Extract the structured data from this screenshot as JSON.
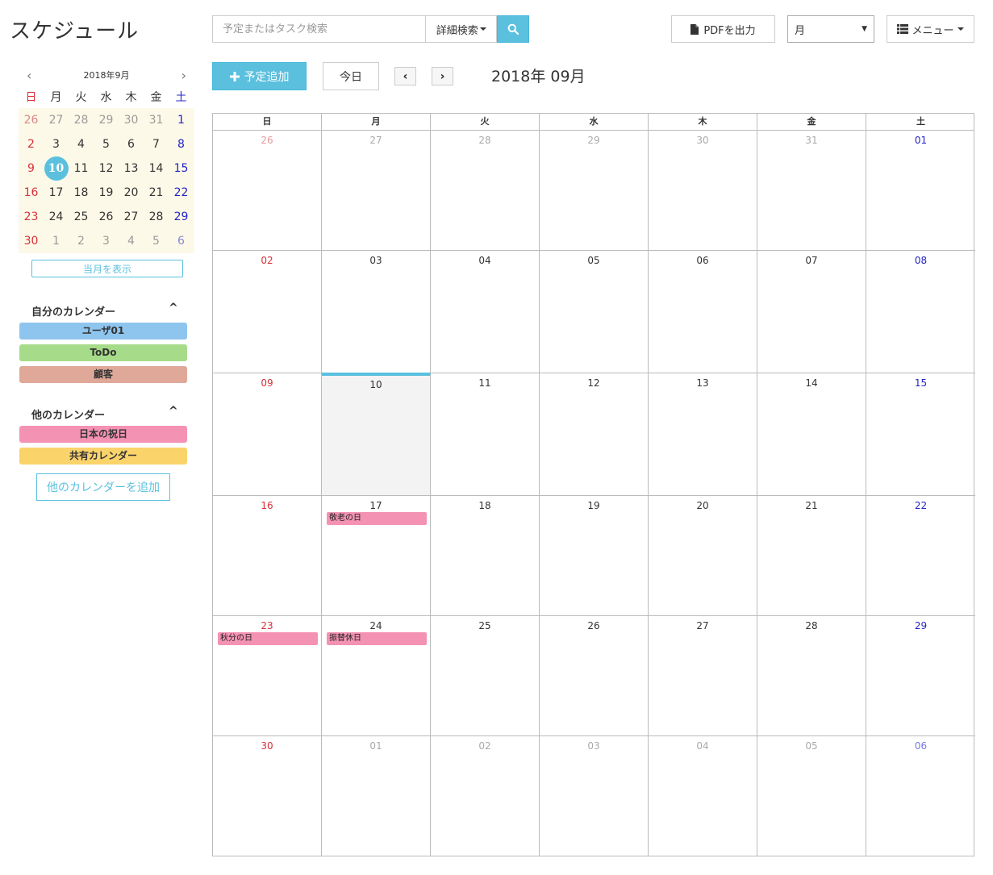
{
  "app_title": "スケジュール",
  "search": {
    "placeholder": "予定またはタスク検索",
    "advanced_label": "詳細検索"
  },
  "toolbar": {
    "pdf_label": "PDFを出力",
    "view_value": "月",
    "menu_label": "メニュー"
  },
  "nav": {
    "add_label": "予定追加",
    "today_label": "今日",
    "prev": "‹",
    "next": "›",
    "month_title": "2018年 09月"
  },
  "weekdays": [
    "日",
    "月",
    "火",
    "水",
    "木",
    "金",
    "土"
  ],
  "calendar": {
    "weeks": [
      [
        "26",
        "27",
        "28",
        "29",
        "30",
        "31",
        "01"
      ],
      [
        "02",
        "03",
        "04",
        "05",
        "06",
        "07",
        "08"
      ],
      [
        "09",
        "10",
        "11",
        "12",
        "13",
        "14",
        "15"
      ],
      [
        "16",
        "17",
        "18",
        "19",
        "20",
        "21",
        "22"
      ],
      [
        "23",
        "24",
        "25",
        "26",
        "27",
        "28",
        "29"
      ],
      [
        "30",
        "01",
        "02",
        "03",
        "04",
        "05",
        "06"
      ]
    ],
    "events": [
      {
        "week": 3,
        "day": 1,
        "label": "敬老の日"
      },
      {
        "week": 4,
        "day": 0,
        "label": "秋分の日"
      },
      {
        "week": 4,
        "day": 1,
        "label": "振替休日"
      }
    ]
  },
  "mini_calendar": {
    "title": "2018年9月",
    "prev": "‹",
    "next": "›",
    "weeks": [
      [
        "26",
        "27",
        "28",
        "29",
        "30",
        "31",
        "1"
      ],
      [
        "2",
        "3",
        "4",
        "5",
        "6",
        "7",
        "8"
      ],
      [
        "9",
        "10",
        "11",
        "12",
        "13",
        "14",
        "15"
      ],
      [
        "16",
        "17",
        "18",
        "19",
        "20",
        "21",
        "22"
      ],
      [
        "23",
        "24",
        "25",
        "26",
        "27",
        "28",
        "29"
      ],
      [
        "30",
        "1",
        "2",
        "3",
        "4",
        "5",
        "6"
      ]
    ],
    "show_month_label": "当月を表示"
  },
  "my_calendars": {
    "title": "自分のカレンダー",
    "toggle": "^",
    "items": [
      {
        "label": "ユーザ01",
        "color": "#8ec5ef"
      },
      {
        "label": "ToDo",
        "color": "#a6db8a"
      },
      {
        "label": "顧客",
        "color": "#e0a898"
      }
    ]
  },
  "other_calendars": {
    "title": "他のカレンダー",
    "toggle": "^",
    "items": [
      {
        "label": "日本の祝日",
        "color": "#f492b4"
      },
      {
        "label": "共有カレンダー",
        "color": "#fbd36b"
      }
    ],
    "add_label": "他のカレンダーを追加"
  },
  "colors": {
    "accent": "#5bc0de",
    "sunday": "#d9303a",
    "saturday": "#2424c9",
    "holiday_event": "#f492b4"
  }
}
